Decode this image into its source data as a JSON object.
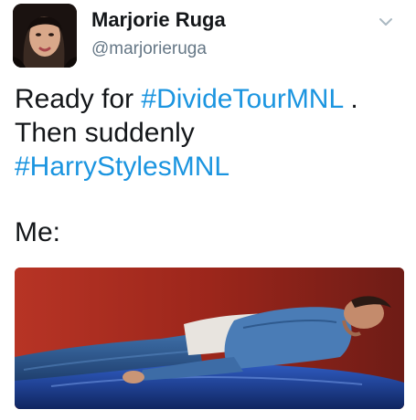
{
  "tweet": {
    "author": {
      "display_name": "Marjorie Ruga",
      "handle": "@marjorieruga",
      "avatar_icon": "profile-photo"
    },
    "menu_icon": "chevron-down-icon",
    "text": {
      "line1_prefix": "Ready for ",
      "hashtag1": "#DivideTourMNL",
      "line1_suffix": " .",
      "line2": "Then suddenly",
      "hashtag2": "#HarryStylesMNL",
      "line4": "Me:"
    },
    "media": {
      "type": "photo"
    }
  },
  "colors": {
    "hashtag": "#1b95e0",
    "secondary_text": "#657786",
    "primary_text": "#14171a",
    "photo_background": "#9a2a20",
    "car_hood": "#1c3f8f"
  }
}
